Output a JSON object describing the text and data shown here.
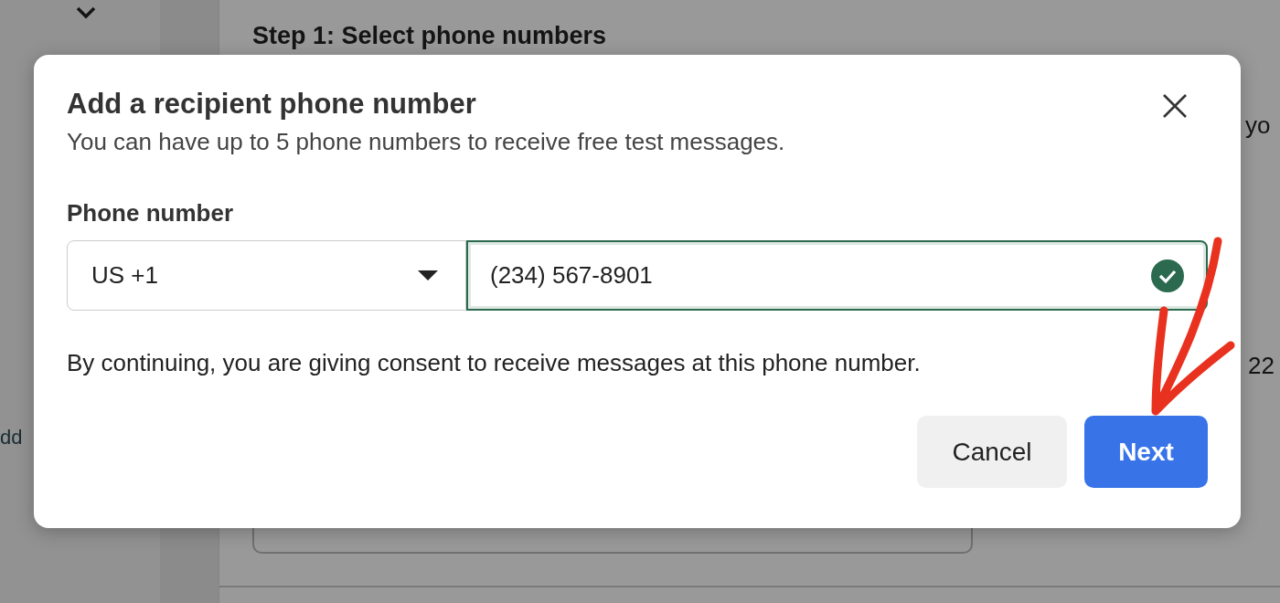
{
  "background": {
    "step_title": "Step 1: Select phone numbers",
    "right_text_top": "yo",
    "right_text_middle": "22",
    "sidebar_text": "dd"
  },
  "dialog": {
    "title": "Add a recipient phone number",
    "subtitle": "You can have up to 5 phone numbers to receive free test messages.",
    "field_label": "Phone number",
    "country": "US +1",
    "phone": "(234) 567-8901",
    "valid": true,
    "consent": "By continuing, you are giving consent to receive messages at this phone number.",
    "buttons": [
      {
        "label": "Cancel",
        "kind": "secondary"
      },
      {
        "label": "Next",
        "kind": "primary"
      }
    ]
  }
}
